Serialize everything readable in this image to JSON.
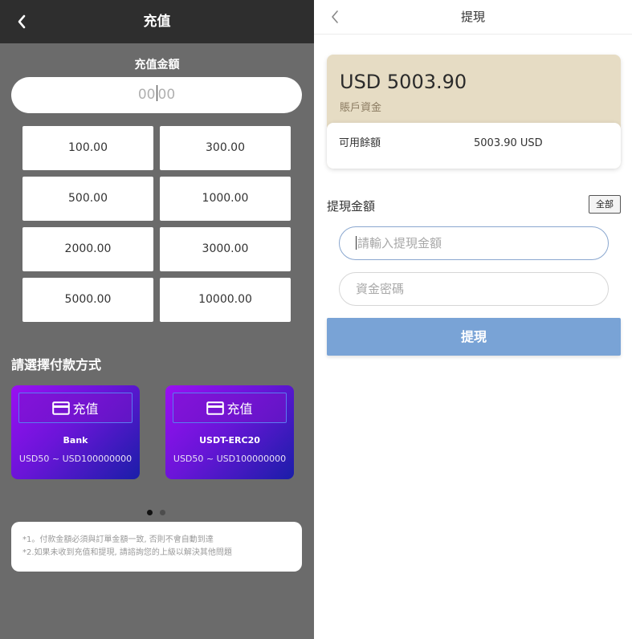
{
  "deposit": {
    "title": "充值",
    "amount_label": "充值金額",
    "amount_placeholder_left": "00",
    "amount_placeholder_right": "00",
    "presets": [
      "100.00",
      "300.00",
      "500.00",
      "1000.00",
      "2000.00",
      "3000.00",
      "5000.00",
      "10000.00"
    ],
    "choose_label": "請選擇付款方式",
    "methods": [
      {
        "button": "充值",
        "name": "Bank",
        "range": "USD50 ~ USD100000000"
      },
      {
        "button": "充值",
        "name": "USDT-ERC20",
        "range": "USD50 ~ USD100000000"
      }
    ],
    "notes": [
      "*1。付款金額必須與訂單金額一致, 否則不會自動到達",
      "*2.如果未收到充值和提現, 請諮詢您的上級以解決其他問題"
    ]
  },
  "withdraw": {
    "title": "提現",
    "balance_amount": "USD 5003.90",
    "balance_label": "賬戶資金",
    "available_label": "可用餘額",
    "available_value": "5003.90 USD",
    "amount_label": "提現金額",
    "all_button": "全部",
    "amount_placeholder": "請輸入提現金額",
    "password_placeholder": "資金密碼",
    "submit": "提現"
  },
  "colors": {
    "left_bg": "#6b6b6b",
    "left_header": "#2e2e2e",
    "card_gradient_start": "#9a10f2",
    "card_gradient_end": "#1a1ea8",
    "balance_card": "#e6dcc4",
    "submit_button": "#79a3d6"
  },
  "icons": {
    "back": "chevron-left-icon",
    "pay": "credit-card-icon"
  }
}
